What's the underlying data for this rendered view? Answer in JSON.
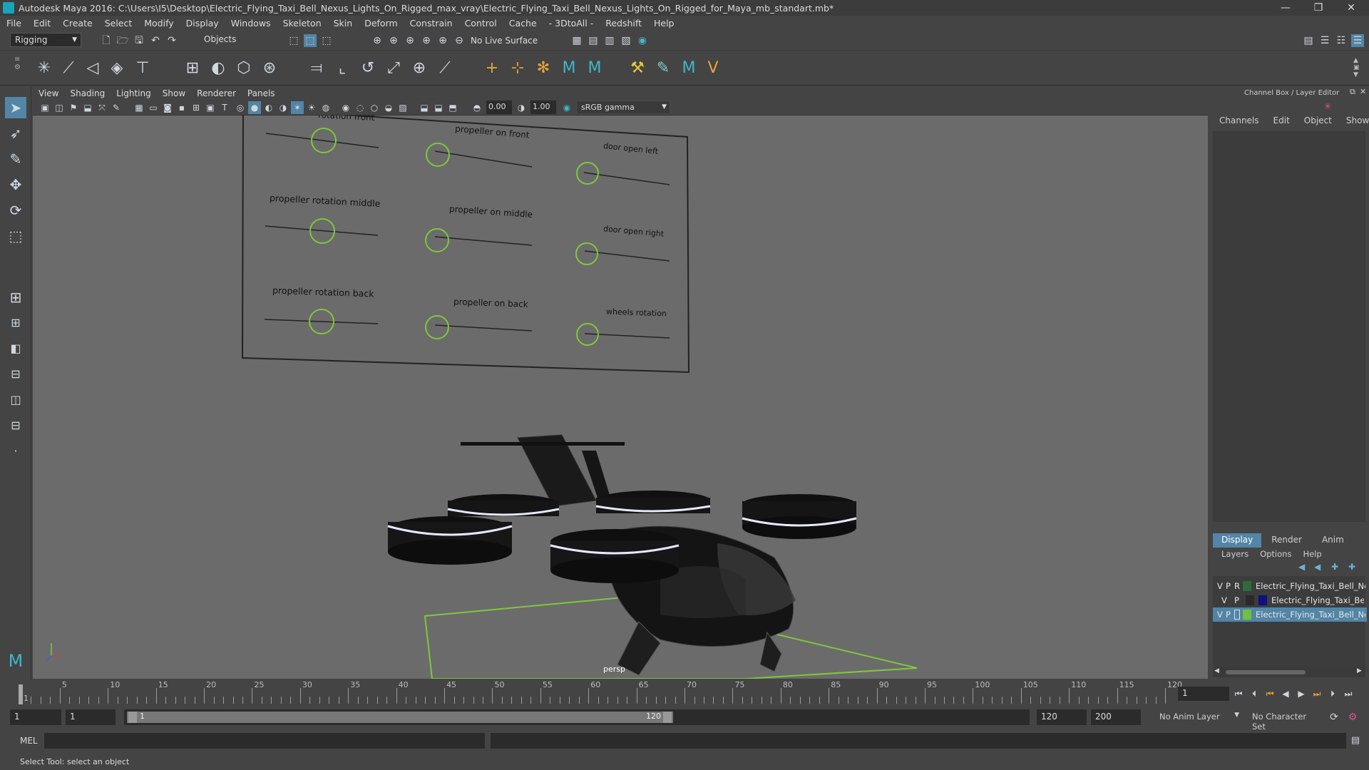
{
  "window": {
    "title": "Autodesk Maya 2016: C:\\Users\\I5\\Desktop\\Electric_Flying_Taxi_Bell_Nexus_Lights_On_Rigged_max_vray\\Electric_Flying_Taxi_Bell_Nexus_Lights_On_Rigged_for_Maya_mb_standart.mb*",
    "minimize": "—",
    "maximize": "❐",
    "close": "✕"
  },
  "menubar": [
    "File",
    "Edit",
    "Create",
    "Select",
    "Modify",
    "Display",
    "Windows",
    "Skeleton",
    "Skin",
    "Deform",
    "Constrain",
    "Control",
    "Cache",
    "- 3DtoAll -",
    "Redshift",
    "Help"
  ],
  "statusline": {
    "mode": "Rigging",
    "select_mode": "Objects",
    "live_surface": "No Live Surface"
  },
  "panel": {
    "menu": [
      "View",
      "Shading",
      "Lighting",
      "Show",
      "Renderer",
      "Panels"
    ],
    "exposure": "0.00",
    "gamma": "1.00",
    "colorspace": "sRGB gamma",
    "camera_label": "persp"
  },
  "rig_panel": {
    "labels": [
      "rotation front",
      "propeller on front",
      "door open left",
      "propeller rotation middle",
      "propeller on middle",
      "door open right",
      "propeller rotation back",
      "propeller on back",
      "wheels rotation"
    ]
  },
  "channel_box": {
    "title": "Channel Box / Layer Editor",
    "menu": [
      "Channels",
      "Edit",
      "Object",
      "Show"
    ]
  },
  "layer_editor": {
    "tabs": [
      "Display",
      "Render",
      "Anim"
    ],
    "menu": [
      "Layers",
      "Options",
      "Help"
    ],
    "layers": [
      {
        "v": "V",
        "p": "P",
        "r": "R",
        "color": "#2e6b3a",
        "name": "Electric_Flying_Taxi_Bell_Nexu",
        "selected": false
      },
      {
        "v": "V",
        "p": "P",
        "r": "",
        "color": "#101080",
        "name": "Electric_Flying_Taxi_Be",
        "selected": false
      },
      {
        "v": "V",
        "p": "P",
        "r": "",
        "color": "#6fc23a",
        "name": "Electric_Flying_Taxi_Bell_Nexu",
        "selected": true
      }
    ]
  },
  "timeslider": {
    "ticks": [
      "1",
      "5",
      "10",
      "15",
      "20",
      "25",
      "30",
      "35",
      "40",
      "45",
      "50",
      "55",
      "60",
      "65",
      "70",
      "75",
      "80",
      "85",
      "90",
      "95",
      "100",
      "105",
      "110",
      "115",
      "120"
    ],
    "current_frame": "1"
  },
  "range": {
    "start": "1",
    "playback_start": "1",
    "range_start_label": "1",
    "range_end_label": "120",
    "playback_end": "120",
    "end": "200",
    "anim_layer": "No Anim Layer",
    "character_set": "No Character Set"
  },
  "cmdline": {
    "label": "MEL"
  },
  "helpline": {
    "text": "Select Tool: select an object"
  },
  "colors": {
    "accent": "#5285a6",
    "control_green": "#7ec83a",
    "selected_row": "#5285a6"
  }
}
